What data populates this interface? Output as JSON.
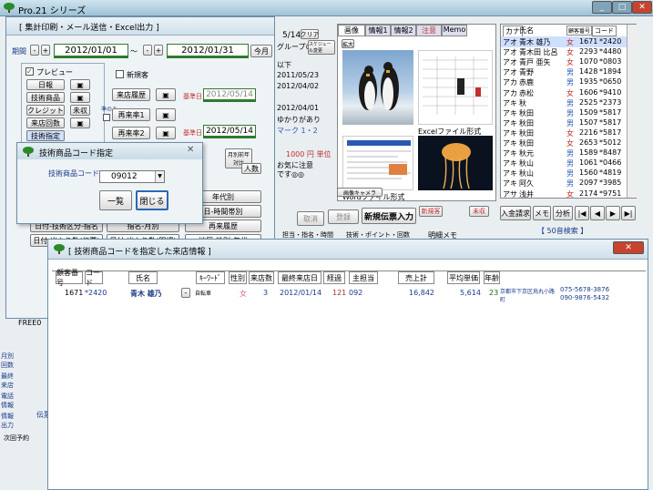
{
  "app": {
    "title": "Pro.21 シリーズ"
  },
  "sheet_window": {
    "title": "[ 集計印刷・メール送信・Excel出力 ]",
    "period_label": "期間",
    "date_from": "2012/01/01",
    "tilde": "～",
    "date_to": "2012/01/31",
    "this_month": "今月",
    "preview_label": "プレビュー",
    "buttons": [
      "日報",
      "技術商品",
      "クレジット",
      "来店回数",
      "技術指定"
    ],
    "minus": "-",
    "plus": "+",
    "new_customer_label": "新規客",
    "mishu_label": "未収",
    "junmi_label": "準のみ",
    "visit_history": "来店履歴",
    "visit_1": "再来率1",
    "visit_2": "再来率2",
    "base_label": "基準日",
    "base_date1": "2012/05/14",
    "base_date2": "2012/05/14",
    "monthly_prev": "月別前年対比",
    "people": "人数",
    "age_btn": "年代別",
    "day_time_btn": "日-時間帯別",
    "day_tech_btn": "日付-技術区分-指名",
    "tech_month_btn": "指名-月別",
    "revisit_btn": "再来履歴",
    "day_in_out": "日付-出入り数(伝票)",
    "day_in_out2": "日付-出入り数(明細)",
    "age_by_area": "地区-性別-年代"
  },
  "middle": {
    "date_frag": "5/14",
    "clear": "クリア",
    "group_only": "グループのみ",
    "schedule_btn": "スケジュール変更",
    "lower": "以下",
    "dates": [
      "2011/05/23",
      "2012/04/02",
      "2012/04/01"
    ],
    "relation": "ゆかりがあり",
    "mark": "マーク 1・2",
    "points": "1000 円 単位",
    "note1": "お気に注意",
    "note2": "です◎◎",
    "new_slip": "新規伝票入力",
    "new_customer": "新規客",
    "mishu": "未収",
    "cancel": "取消",
    "register": "登録",
    "detail_memo": "明細メモ",
    "tech_point": "技術・ポイント・回数",
    "staff_time": "担当・指名・時間"
  },
  "image_panel": {
    "tabs": [
      "画像",
      "情報1",
      "情報2",
      "注意",
      "Memo"
    ],
    "enlarge": "拡大",
    "excel_label": "Excelファイル形式",
    "word_label": "Wordファイル形式",
    "camera_btn": "画像キャメラ"
  },
  "customer_list": {
    "headers": [
      "カナ",
      "氏名",
      "顧客番号",
      "コード"
    ],
    "rows": [
      {
        "kana": "アオ",
        "name": "青木 雄乃",
        "sex": "女",
        "no": "1671",
        "code": "*2420"
      },
      {
        "kana": "アオ",
        "name": "青木田 比呂",
        "sex": "女",
        "no": "2293",
        "code": "*4480"
      },
      {
        "kana": "アオ",
        "name": "青戸 亜矢",
        "sex": "女",
        "no": "1070",
        "code": "*0803"
      },
      {
        "kana": "アオ",
        "name": "青野",
        "sex": "男",
        "no": "1428",
        "code": "*1894"
      },
      {
        "kana": "アカ",
        "name": "赤鹿",
        "sex": "男",
        "no": "1935",
        "code": "*0650"
      },
      {
        "kana": "アカ",
        "name": "赤松",
        "sex": "女",
        "no": "1606",
        "code": "*9410"
      },
      {
        "kana": "アキ",
        "name": "秋",
        "sex": "男",
        "no": "2525",
        "code": "*2373"
      },
      {
        "kana": "アキ",
        "name": "秋田",
        "sex": "男",
        "no": "1509",
        "code": "*5817"
      },
      {
        "kana": "アキ",
        "name": "秋田",
        "sex": "男",
        "no": "1507",
        "code": "*5817"
      },
      {
        "kana": "アキ",
        "name": "秋田",
        "sex": "女",
        "no": "2216",
        "code": "*5817"
      },
      {
        "kana": "アキ",
        "name": "秋田",
        "sex": "女",
        "no": "2653",
        "code": "*5012"
      },
      {
        "kana": "アキ",
        "name": "秋元",
        "sex": "男",
        "no": "1589",
        "code": "*8487"
      },
      {
        "kana": "アキ",
        "name": "秋山",
        "sex": "男",
        "no": "1061",
        "code": "*0466"
      },
      {
        "kana": "アキ",
        "name": "秋山",
        "sex": "男",
        "no": "1560",
        "code": "*4819"
      },
      {
        "kana": "アキ",
        "name": "阿久",
        "sex": "男",
        "no": "2097",
        "code": "*3985"
      },
      {
        "kana": "アサ",
        "name": "浅井",
        "sex": "女",
        "no": "2174",
        "code": "*9751"
      }
    ],
    "nav": [
      "入金請求",
      "メモ",
      "分析"
    ],
    "kana_search": "【 50音検索 】"
  },
  "left_side_labels": [
    "月別回数",
    "最終来店",
    "電話情報",
    "情報出力"
  ],
  "free_label": "FREE0",
  "slip_label": "伝票番",
  "next_label": "次回予約",
  "dialog": {
    "title": "技術商品コード指定",
    "code_label": "技術商品コード",
    "code_value": "09012",
    "list_btn": "一覧",
    "close_btn": "閉じる"
  },
  "result_window": {
    "title": "[ 技術商品コードを指定した来店情報 ]",
    "columns": [
      "顧客番号",
      "コード",
      "氏名",
      "ｷｰﾜｰﾄﾞ",
      "性別",
      "来店数",
      "最終来店日",
      "経過",
      "主担当",
      "売上計",
      "平均単価",
      "年齢"
    ],
    "row": {
      "no": "1671",
      "code": "*2420",
      "name": "青木 雄乃",
      "keyword": "自転車",
      "sex": "女",
      "visits": "3",
      "last_visit": "2012/01/14",
      "elapsed": "121",
      "staff": "092",
      "sales": "16,842",
      "avg": "5,614",
      "age": "23",
      "address": "京都市下京区烏丸小路町",
      "tel1": "075-5678-3876",
      "tel2": "090-9876-5432"
    }
  }
}
